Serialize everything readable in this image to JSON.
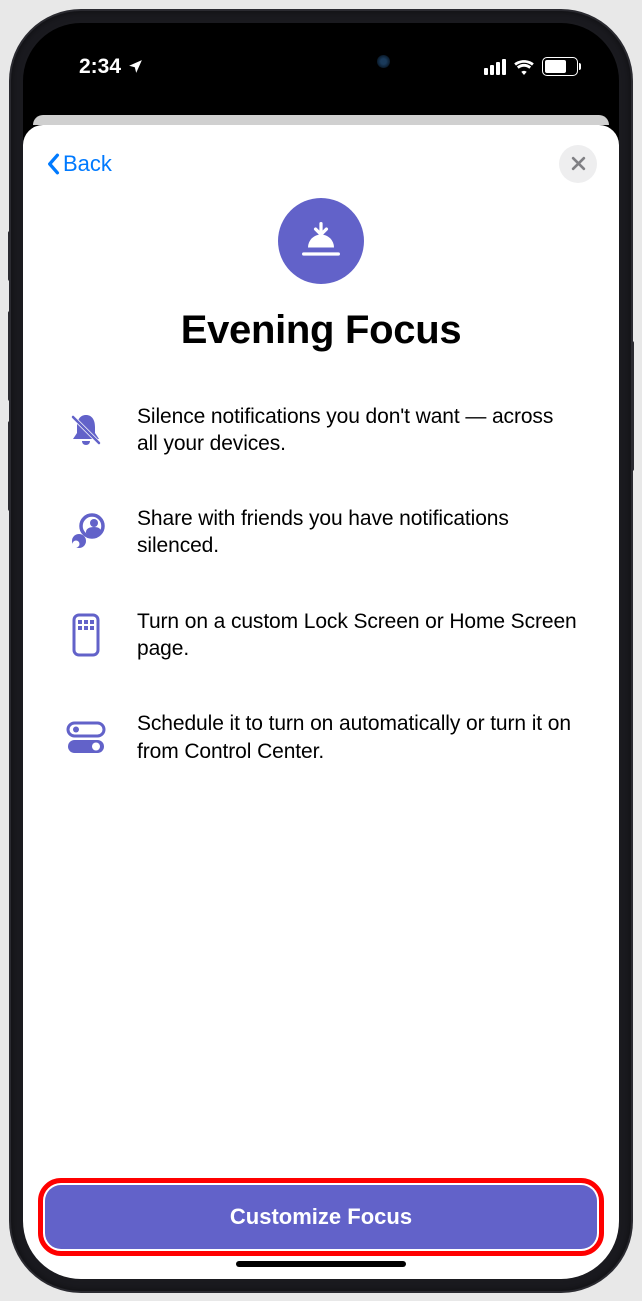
{
  "status_bar": {
    "time": "2:34",
    "battery_percent": "63"
  },
  "header": {
    "back_label": "Back"
  },
  "hero": {
    "title": "Evening Focus"
  },
  "features": [
    {
      "text": "Silence notifications you don't want — across all your devices."
    },
    {
      "text": "Share with friends you have notifications silenced."
    },
    {
      "text": "Turn on a custom Lock Screen or Home Screen page."
    },
    {
      "text": "Schedule it to turn on automatically or turn it on from Control Center."
    }
  ],
  "footer": {
    "button_label": "Customize Focus"
  },
  "colors": {
    "accent": "#6262c9",
    "link": "#007AFF",
    "highlight": "#ff0000"
  }
}
